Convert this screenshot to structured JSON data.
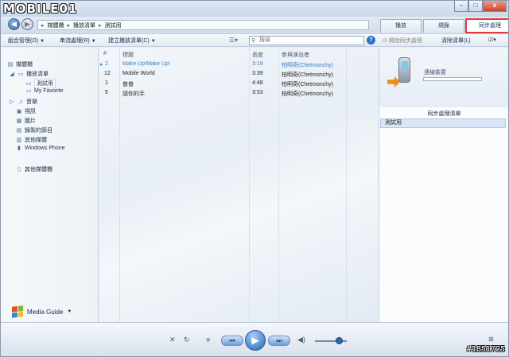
{
  "app": {
    "logo": "MOBILE01"
  },
  "window_controls": {
    "minimize": "–",
    "maximize": "□",
    "close": "x"
  },
  "breadcrumb": {
    "items": [
      "媒體櫃",
      "播放清單",
      "測試用"
    ]
  },
  "tabs": [
    {
      "label": "播放",
      "active": false
    },
    {
      "label": "燒錄",
      "active": false
    },
    {
      "label": "同步處理",
      "active": true
    }
  ],
  "toolbar": {
    "organize": "組合管理(O)",
    "stream": "串流處理(R)",
    "create_playlist": "建立播放清單(C)",
    "search_placeholder": "搜尋",
    "start_sync": "開始同步處理",
    "clear_list": "清除清單(L)"
  },
  "sidebar": {
    "items": [
      {
        "label": "媒體櫃",
        "icon": "library-icon"
      },
      {
        "label": "播放清單",
        "icon": "playlist-icon"
      },
      {
        "label": "測試用",
        "icon": "playlist-icon"
      },
      {
        "label": "My Favorite",
        "icon": "playlist-icon"
      },
      {
        "label": "音樂",
        "icon": "music-icon"
      },
      {
        "label": "視訊",
        "icon": "video-icon"
      },
      {
        "label": "圖片",
        "icon": "picture-icon"
      },
      {
        "label": "錄製的節目",
        "icon": "recorded-tv-icon"
      },
      {
        "label": "其他媒體",
        "icon": "other-media-icon"
      },
      {
        "label": "Windows Phone",
        "icon": "phone-icon"
      },
      {
        "label": "其他媒體櫃",
        "icon": "other-library-icon"
      }
    ],
    "media_guide": "Media Guide"
  },
  "table": {
    "columns": [
      "#",
      "標題",
      "長度",
      "參與演出者"
    ],
    "rows": [
      {
        "num": "2",
        "title": "Make Up!Make Up!",
        "length": "3:19",
        "artist": "柏明奇(Chetmonchy)",
        "playing": true
      },
      {
        "num": "12",
        "title": "Mobile World",
        "length": "3:39",
        "artist": "柏明奇(Chetmonchy)",
        "playing": false
      },
      {
        "num": "1",
        "title": "普普",
        "length": "4:48",
        "artist": "柏明奇(Chetmonchy)",
        "playing": false
      },
      {
        "num": "5",
        "title": "請你的手",
        "length": "3:53",
        "artist": "柏明奇(Chetmonchy)",
        "playing": false
      }
    ]
  },
  "sync_pane": {
    "device_status": "連線裝置",
    "list_title": "同步處理清單",
    "list_items": [
      "測試用"
    ]
  },
  "player": {
    "shuffle": "✕",
    "repeat": "↻",
    "stop": "■",
    "prev": "⏮",
    "play": "▶",
    "next": "⏭",
    "volume": "◀)",
    "switch": "⊞",
    "volume_level": 0.75
  },
  "watermark": "#1851725",
  "colors": {
    "accent": "#2e6fc8",
    "highlight": "#e23a3a",
    "playing": "#3a7fc4"
  }
}
